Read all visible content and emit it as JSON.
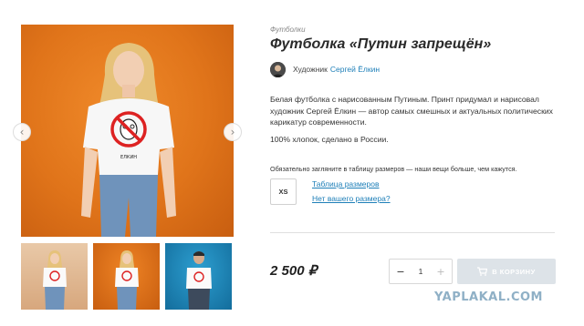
{
  "product": {
    "category": "Футболки",
    "title": "Футболка «Путин запрещён»",
    "artist_label": "Художник",
    "artist_name": "Сергей Ёлкин",
    "description": "Белая футболка с нарисованным Путиным. Принт придумал и нарисовал художник Сергей Ёлкин — автор самых смешных и актуальных политических карикатур современности.",
    "material": "100% хлопок, сделано в России.",
    "size_note": "Обязательно загляните в таблицу размеров — наши вещи больше, чем кажутся.",
    "size": "XS",
    "size_table_link": "Таблица размеров",
    "no_size_link": "Нет вашего размера?",
    "price": "2 500 ₽",
    "quantity": "1",
    "qty_minus": "−",
    "qty_plus": "+",
    "cart_label": "В КОРЗИНУ",
    "print_caption": "ЕЛКИН"
  },
  "gallery": {
    "prev_icon": "‹",
    "next_icon": "›",
    "thumbnails": [
      "thumb-1",
      "thumb-2",
      "thumb-3"
    ]
  },
  "watermark": "YAPLAKAL.COM",
  "colors": {
    "link": "#1e7fb8",
    "cart_button": "#dde3e8",
    "main_bg": "#e0741a",
    "thumb_blue": "#2d9fd1"
  }
}
